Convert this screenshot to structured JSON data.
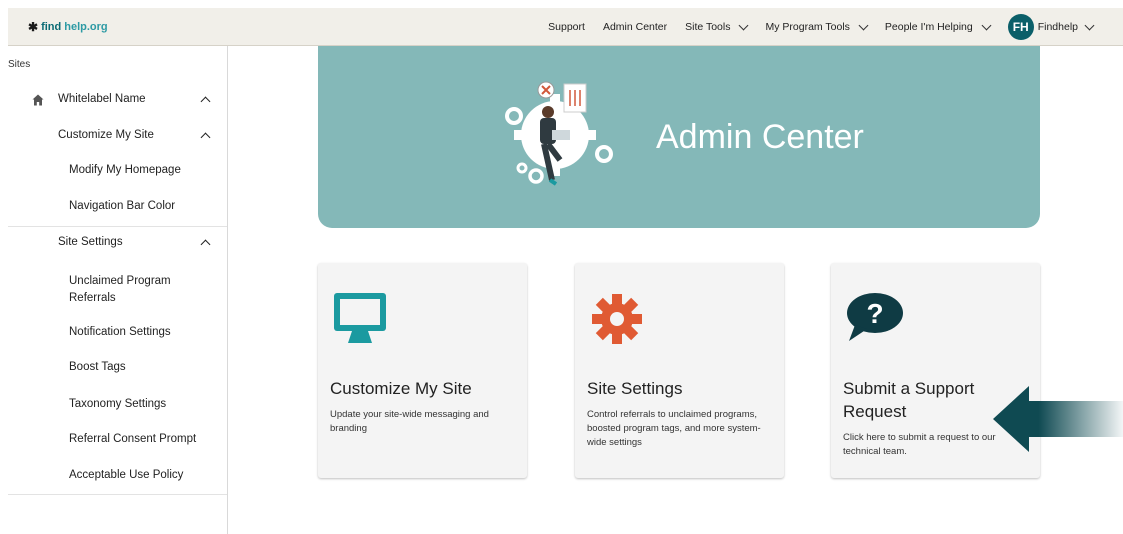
{
  "header": {
    "logo_prefix": "find",
    "logo_suffix": "help.org",
    "nav": [
      "Support",
      "Admin Center",
      "Site Tools",
      "My Program Tools",
      "People I'm Helping"
    ],
    "avatar_initials": "FH",
    "user_name": "Findhelp"
  },
  "sidebar": {
    "section_label": "Sites",
    "items": [
      {
        "label": "Whitelabel Name"
      },
      {
        "label": "Customize My Site"
      },
      {
        "label": "Modify My Homepage"
      },
      {
        "label": "Navigation Bar Color"
      },
      {
        "label": "Site Settings"
      },
      {
        "label": "Unclaimed Program Referrals"
      },
      {
        "label": "Notification Settings"
      },
      {
        "label": "Boost Tags"
      },
      {
        "label": "Taxonomy Settings"
      },
      {
        "label": "Referral Consent Prompt"
      },
      {
        "label": "Acceptable Use Policy"
      }
    ]
  },
  "hero": {
    "title": "Admin Center"
  },
  "cards": [
    {
      "title": "Customize My Site",
      "description": "Update your site-wide messaging and branding",
      "icon": "monitor-icon"
    },
    {
      "title": "Site Settings",
      "description": "Control referrals to unclaimed programs, boosted program tags, and more system-wide settings",
      "icon": "gear-icon"
    },
    {
      "title": "Submit a Support Request",
      "description": "Click here to submit a request to our technical team.",
      "icon": "question-bubble-icon"
    }
  ],
  "colors": {
    "teal_dark": "#0b5f69",
    "hero_bg": "#84b8b8",
    "monitor": "#1b9aa0",
    "gear": "#e05a33",
    "bubble": "#0f3b44"
  }
}
